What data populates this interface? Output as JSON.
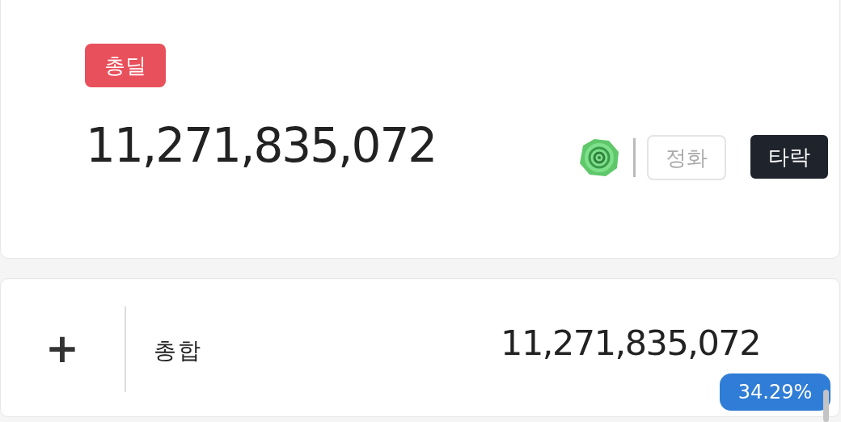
{
  "damage_card": {
    "badge": "총딜",
    "total": "11,271,835,072",
    "modes": [
      {
        "label": "정화",
        "selected": false
      },
      {
        "label": "타락",
        "selected": true
      }
    ]
  },
  "summary_card": {
    "expand_symbol": "+",
    "label": "총합",
    "value": "11,271,835,072",
    "percent": "34.29%"
  }
}
